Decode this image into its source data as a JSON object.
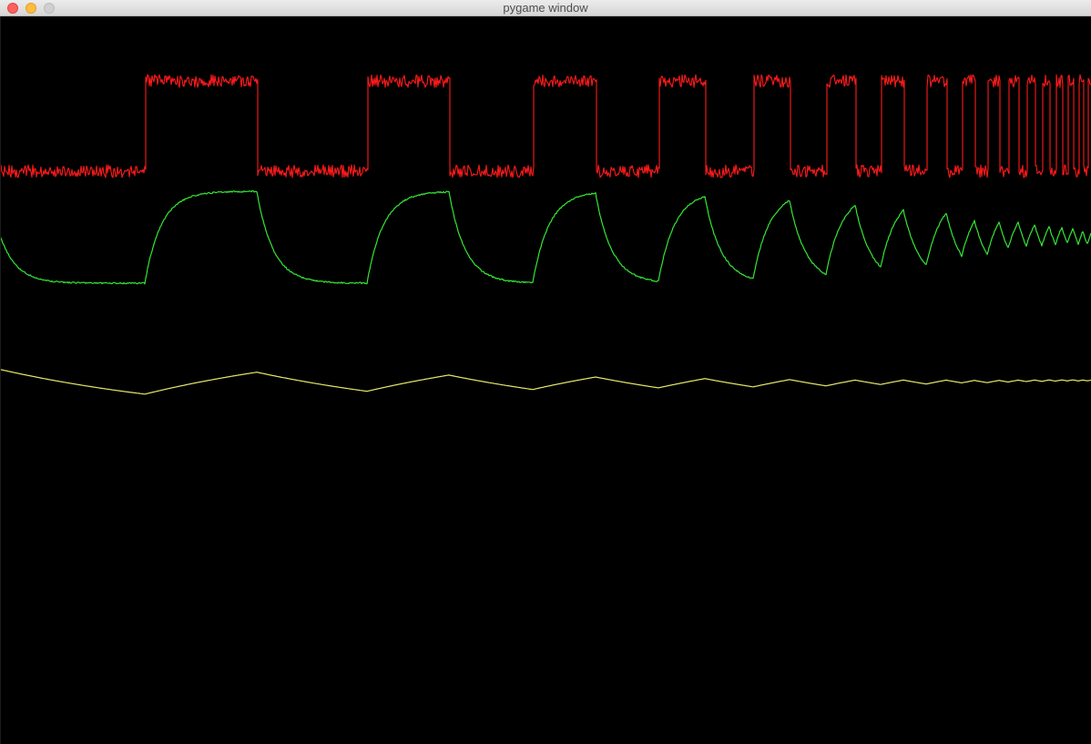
{
  "window": {
    "title": "pygame window"
  },
  "colors": {
    "background": "#000000",
    "titlebar": "#e3e3e3",
    "close": "#fc605c",
    "minimize": "#fdbc40",
    "zoom": "#cfcfcf"
  },
  "chart_data": {
    "type": "line",
    "title": "",
    "xlabel": "",
    "ylabel": "",
    "series": [
      {
        "color": "#ff1a1a",
        "description_kind": "noisy square wave with increasing frequency"
      },
      {
        "color": "#33e633",
        "description_kind": "first-order response to square wave"
      },
      {
        "color": "#e8e86a",
        "description_kind": "slow low-pass response (triangle-like)"
      }
    ],
    "square_transition_times": [
      160,
      283,
      404,
      494,
      586,
      655,
      724,
      775,
      828,
      868,
      908,
      940,
      968,
      993,
      1018,
      1040,
      1057,
      1071,
      1085,
      1098,
      1108,
      1119,
      1128,
      1137,
      1145,
      1153,
      1160,
      1167,
      1173,
      1179,
      1185,
      1190,
      1195
    ]
  }
}
